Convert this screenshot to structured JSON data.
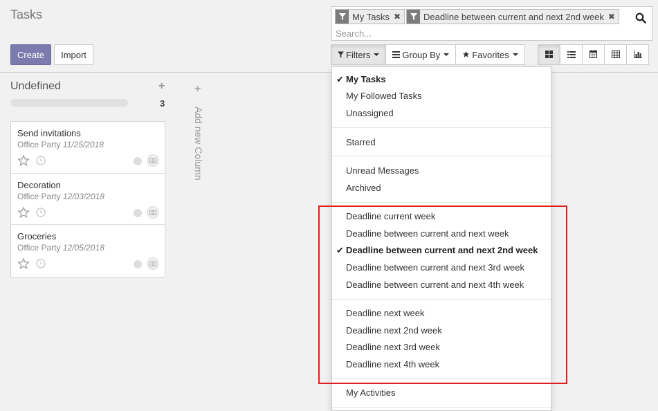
{
  "page": {
    "title": "Tasks"
  },
  "search": {
    "facets": [
      {
        "label": "My Tasks"
      },
      {
        "label": "Deadline between current and next 2nd week"
      }
    ],
    "placeholder": "Search..."
  },
  "toolbar": {
    "create_label": "Create",
    "import_label": "Import",
    "filters_label": "Filters",
    "groupby_label": "Group By",
    "favorites_label": "Favorites"
  },
  "view_switcher": [
    "kanban-icon",
    "list-icon",
    "calendar-icon",
    "pivot-icon",
    "graph-icon"
  ],
  "kanban": {
    "column": {
      "title": "Undefined",
      "count": "3"
    },
    "cards": [
      {
        "name": "Send invitations",
        "project": "Office Party",
        "date": "11/25/2018"
      },
      {
        "name": "Decoration",
        "project": "Office Party",
        "date": "12/03/2018"
      },
      {
        "name": "Groceries",
        "project": "Office Party",
        "date": "12/05/2018"
      }
    ],
    "add_column_label": "Add new Column"
  },
  "filters_menu": {
    "groups": [
      {
        "items": [
          {
            "label": "My Tasks",
            "checked": true
          },
          {
            "label": "My Followed Tasks",
            "checked": false
          },
          {
            "label": "Unassigned",
            "checked": false
          }
        ]
      },
      {
        "items": [
          {
            "label": "Starred",
            "checked": false
          }
        ]
      },
      {
        "items": [
          {
            "label": "Unread Messages",
            "checked": false
          },
          {
            "label": "Archived",
            "checked": false
          }
        ]
      },
      {
        "items": [
          {
            "label": "Deadline current week",
            "checked": false
          },
          {
            "label": "Deadline between current and next week",
            "checked": false
          },
          {
            "label": "Deadline between current and next 2nd week",
            "checked": true
          },
          {
            "label": "Deadline between current and next 3rd week",
            "checked": false
          },
          {
            "label": "Deadline between current and next 4th week",
            "checked": false
          }
        ]
      },
      {
        "items": [
          {
            "label": "Deadline next week",
            "checked": false
          },
          {
            "label": "Deadline next 2nd week",
            "checked": false
          },
          {
            "label": "Deadline next 3rd week",
            "checked": false
          },
          {
            "label": "Deadline next 4th week",
            "checked": false
          }
        ]
      },
      {
        "items": [
          {
            "label": "My Activities",
            "checked": false
          }
        ]
      }
    ]
  },
  "colors": {
    "primary": "#7c7bad",
    "highlight": "#e02020"
  }
}
